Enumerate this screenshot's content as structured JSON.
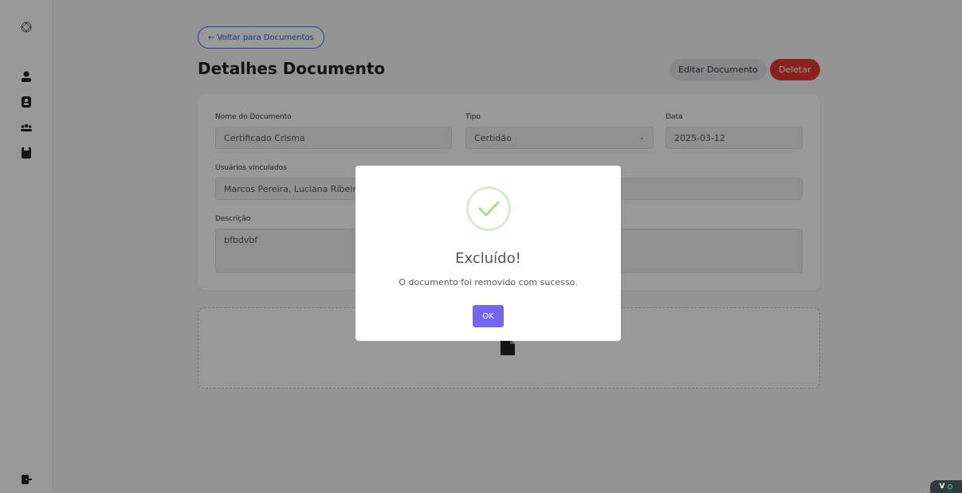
{
  "sidebar": {
    "icons": [
      "logo-icon",
      "user-icon",
      "profile-icon",
      "group-icon",
      "document-icon",
      "logout-icon"
    ]
  },
  "header": {
    "back_label": "← Voltar para Documentos",
    "title": "Detalhes Documento",
    "edit_label": "Editar Documento",
    "delete_label": "Deletar"
  },
  "form": {
    "name_label": "Nome do Documento",
    "name_value": "Certificado Crisma",
    "type_label": "Tipo",
    "type_value": "Certidão",
    "date_label": "Data",
    "date_value": "2025-03-12",
    "users_label": "Usuários vinculados",
    "users_value": "Marcos Pereira, Luciana Ribeiro",
    "desc_label": "Descrição",
    "desc_value": "bfbdvbf"
  },
  "modal": {
    "title": "Excluído!",
    "message": "O documento foi removido com sucesso.",
    "ok_label": "OK"
  },
  "badge": {
    "label": "V"
  },
  "colors": {
    "accent": "#7367f0",
    "danger": "#e53935",
    "primary": "#2b5cc9",
    "success": "#a5dc86"
  }
}
